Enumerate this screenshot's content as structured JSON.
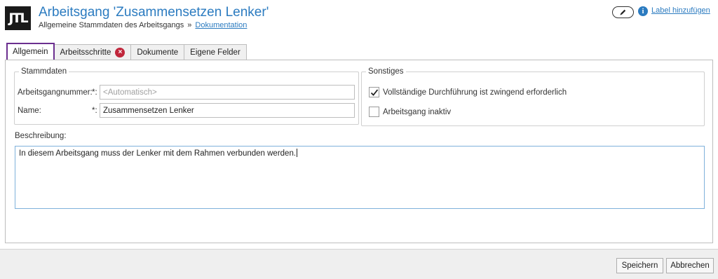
{
  "header": {
    "logo_text": "JTL",
    "title": "Arbeitsgang 'Zusammensetzen Lenker'",
    "subtitle": "Allgemeine Stammdaten des Arbeitsgangs",
    "subtitle_sep": "»",
    "doc_link": "Dokumentation",
    "edit_icon": "pencil-icon",
    "info_icon": "i",
    "label_link": "Label hinzufügen"
  },
  "tabs": [
    {
      "label": "Allgemein",
      "active": true
    },
    {
      "label": "Arbeitsschritte",
      "error_badge": "×"
    },
    {
      "label": "Dokumente"
    },
    {
      "label": "Eigene Felder"
    }
  ],
  "stammdaten": {
    "legend": "Stammdaten",
    "number_label": "Arbeitsgangnummer:",
    "number_req": "*:",
    "number_placeholder": "<Automatisch>",
    "name_label": "Name:",
    "name_req": "*:",
    "name_value": "Zusammensetzen Lenker"
  },
  "sonstiges": {
    "legend": "Sonstiges",
    "opt1_label": "Vollständige Durchführung ist zwingend erforderlich",
    "opt1_checked": true,
    "opt2_label": "Arbeitsgang inaktiv",
    "opt2_checked": false
  },
  "description": {
    "label": "Beschreibung:",
    "value": "In diesem Arbeitsgang muss der Lenker mit dem Rahmen verbunden werden."
  },
  "footer": {
    "save_label": "Speichern",
    "cancel_label": "Abbrechen"
  },
  "colors": {
    "accent": "#2b7bc0",
    "active_tab_border": "#6b2f8f",
    "error": "#c0263b"
  }
}
